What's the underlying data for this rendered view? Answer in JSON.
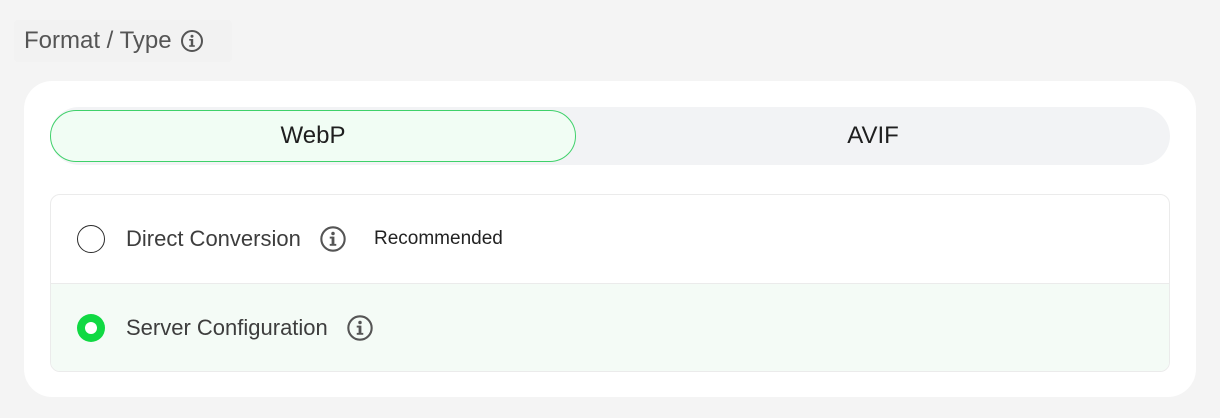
{
  "section": {
    "title": "Format / Type",
    "info_icon": "info-circle-icon"
  },
  "format_toggle": {
    "options": [
      {
        "label": "WebP",
        "selected": true
      },
      {
        "label": "AVIF",
        "selected": false
      }
    ]
  },
  "methods": [
    {
      "label": "Direct Conversion",
      "info_icon": "info-circle-icon",
      "badge": "Recommended",
      "selected": false
    },
    {
      "label": "Server Configuration",
      "info_icon": "info-circle-icon",
      "selected": true
    }
  ],
  "colors": {
    "accent": "#10d943",
    "selected_border": "#3fd16a",
    "selected_bg": "#f1fdf4",
    "row_selected_bg": "#f4fbf6"
  }
}
